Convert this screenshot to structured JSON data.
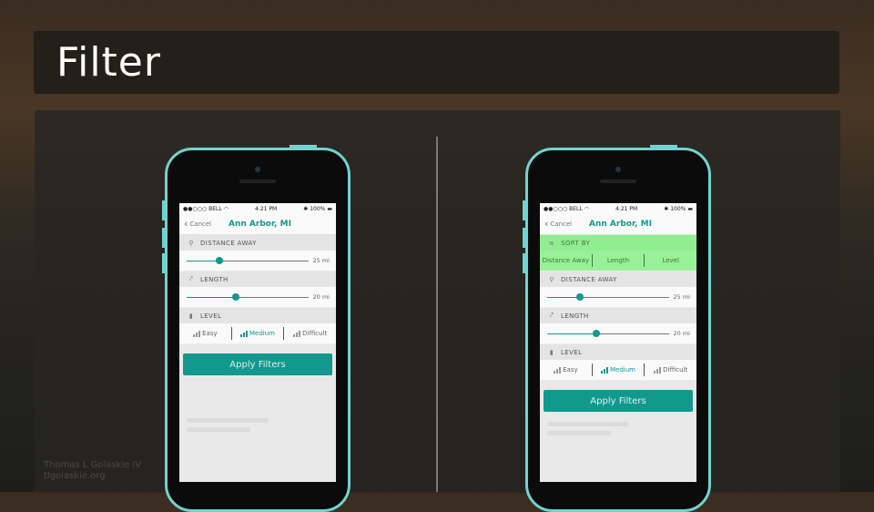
{
  "slide": {
    "title": "Filter",
    "credit_line1": "Thomas L Golaskie IV",
    "credit_line2": "tlgolaskie.org"
  },
  "colors": {
    "accent": "#13988e",
    "phone_frame": "#6fd4cf",
    "sort_highlight": "#90ee90"
  },
  "phone_left": {
    "status": {
      "carrier": "●●○○○ BELL",
      "time": "4:21 PM",
      "battery": "100%"
    },
    "nav": {
      "cancel": "Cancel",
      "title": "Ann Arbor, MI"
    },
    "distance": {
      "label": "DISTANCE AWAY",
      "icon": "location-pin-icon",
      "value": "25 mi",
      "level": 0.27
    },
    "length": {
      "label": "LENGTH",
      "icon": "path-icon",
      "value": "20 mi",
      "level": 0.4
    },
    "level": {
      "label": "LEVEL",
      "icon": "level-bars-icon",
      "options": [
        "Easy",
        "Medium",
        "Difficult"
      ],
      "selected": "Medium"
    },
    "apply_label": "Apply Filters"
  },
  "phone_right": {
    "status": {
      "carrier": "●●○○○ BELL",
      "time": "4:21 PM",
      "battery": "100%"
    },
    "nav": {
      "cancel": "Cancel",
      "title": "Ann Arbor, MI"
    },
    "sort": {
      "label": "SORT BY",
      "icon": "sort-icon",
      "options": [
        "Distance Away",
        "Length",
        "Level"
      ]
    },
    "distance": {
      "label": "DISTANCE AWAY",
      "icon": "location-pin-icon",
      "value": "25 mi",
      "level": 0.27
    },
    "length": {
      "label": "LENGTH",
      "icon": "path-icon",
      "value": "20 mi",
      "level": 0.4
    },
    "level": {
      "label": "LEVEL",
      "icon": "level-bars-icon",
      "options": [
        "Easy",
        "Medium",
        "Difficult"
      ],
      "selected": "Medium"
    },
    "apply_label": "Apply Filters"
  }
}
